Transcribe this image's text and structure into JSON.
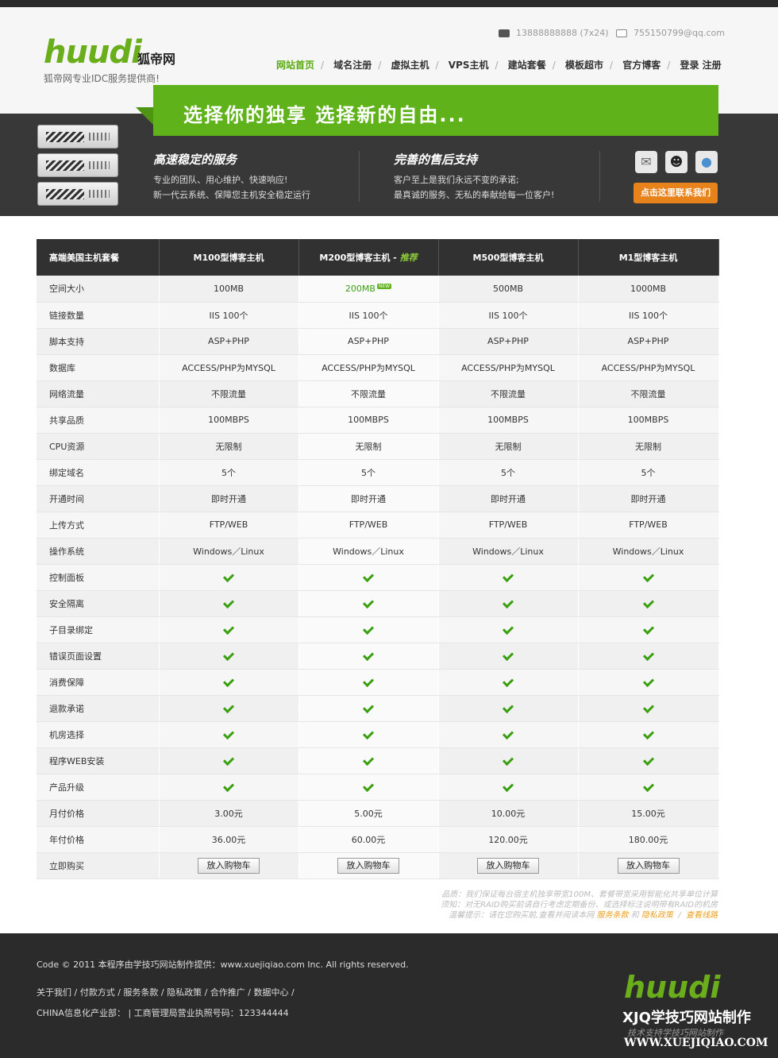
{
  "header": {
    "logo_en": "huudi",
    "logo_cn": "狐帝网",
    "logo_sub": "狐帝网专业IDC服务提供商!",
    "phone": "13888888888 (7x24)",
    "email": "755150799@qq.com",
    "nav": [
      "网站首页",
      "域名注册",
      "虚拟主机",
      "VPS主机",
      "建站套餐",
      "模板超市",
      "官方博客",
      "登录 注册"
    ]
  },
  "banner": {
    "slogan": "选择你的独享 选择新的自由...",
    "feature1_title": "高速稳定的服务",
    "feature1_line1": "专业的团队、用心维护、快速响应!",
    "feature1_line2": "新一代云系统、保障您主机安全稳定运行",
    "feature2_title": "完善的售后支持",
    "feature2_line1": "客户至上是我们永远不变的承诺;",
    "feature2_line2": "最真诚的服务、无私的奉献给每一位客户!",
    "contact_button": "点击这里联系我们"
  },
  "table": {
    "corner": "高端美国主机套餐",
    "plans": [
      "M100型博客主机",
      "M200型博客主机",
      "M500型博客主机",
      "M1型博客主机"
    ],
    "recommend": "推荐",
    "new_badge": "NEW",
    "rows": [
      {
        "label": "空间大小",
        "values": [
          "100MB",
          "200MB",
          "500MB",
          "1000MB"
        ]
      },
      {
        "label": "链接数量",
        "values": [
          "IIS 100个",
          "IIS 100个",
          "IIS 100个",
          "IIS 100个"
        ]
      },
      {
        "label": "脚本支持",
        "values": [
          "ASP+PHP",
          "ASP+PHP",
          "ASP+PHP",
          "ASP+PHP"
        ]
      },
      {
        "label": "数据库",
        "values": [
          "ACCESS/PHP为MYSQL",
          "ACCESS/PHP为MYSQL",
          "ACCESS/PHP为MYSQL",
          "ACCESS/PHP为MYSQL"
        ]
      },
      {
        "label": "网络流量",
        "values": [
          "不限流量",
          "不限流量",
          "不限流量",
          "不限流量"
        ]
      },
      {
        "label": "共享品质",
        "values": [
          "100MBPS",
          "100MBPS",
          "100MBPS",
          "100MBPS"
        ]
      },
      {
        "label": "CPU资源",
        "values": [
          "无限制",
          "无限制",
          "无限制",
          "无限制"
        ]
      },
      {
        "label": "绑定域名",
        "values": [
          "5个",
          "5个",
          "5个",
          "5个"
        ]
      },
      {
        "label": "开通时间",
        "values": [
          "即时开通",
          "即时开通",
          "即时开通",
          "即时开通"
        ]
      },
      {
        "label": "上传方式",
        "values": [
          "FTP/WEB",
          "FTP/WEB",
          "FTP/WEB",
          "FTP/WEB"
        ]
      },
      {
        "label": "操作系统",
        "values": [
          "Windows／Linux",
          "Windows／Linux",
          "Windows／Linux",
          "Windows／Linux"
        ]
      }
    ],
    "check_rows": [
      "控制面板",
      "安全隔离",
      "子目录绑定",
      "错误页面设置",
      "消费保障",
      "退款承诺",
      "机房选择",
      "程序WEB安装",
      "产品升级"
    ],
    "price_rows": [
      {
        "label": "月付价格",
        "values": [
          "3.00元",
          "5.00元",
          "10.00元",
          "15.00元"
        ]
      },
      {
        "label": "年付价格",
        "values": [
          "36.00元",
          "60.00元",
          "120.00元",
          "180.00元"
        ]
      }
    ],
    "buy_label": "立即购买",
    "cart_button": "放入购物车"
  },
  "notes": {
    "line1": "品质：我们保证每台宿主机独享带宽100M、套餐带宽采用智能化共享单位计算",
    "line2": "须知：对无RAID购买前请自行考虑定期备份、或选择标注说明带有RAID的机房",
    "line3_prefix": "温馨提示：请在您购买前,查看并阅读本网",
    "link_terms": "服务条款",
    "and": "和",
    "link_privacy": "隐私政策",
    "slash": "/",
    "link_lines": "查看线路"
  },
  "footer": {
    "copyright": "Code © 2011 本程序由学技巧网站制作提供：www.xuejiqiao.com Inc. All rights reserved.",
    "links": "关于我们 / 付款方式 / 服务条款 / 隐私政策 / 合作推广 / 数据中心 /",
    "license": "CHINA信息化产业部： | 工商管理局营业执照号码：123344444",
    "logo": "huudi",
    "wm_title": "XJQ学技巧网站制作",
    "wm_sub": "技术支持学技巧网站制作",
    "wm_url": "WWW.XUEJIQIAO.COM"
  },
  "colors": {
    "accent": "#5fb21a",
    "dark": "#383838",
    "orange": "#e8821a"
  }
}
